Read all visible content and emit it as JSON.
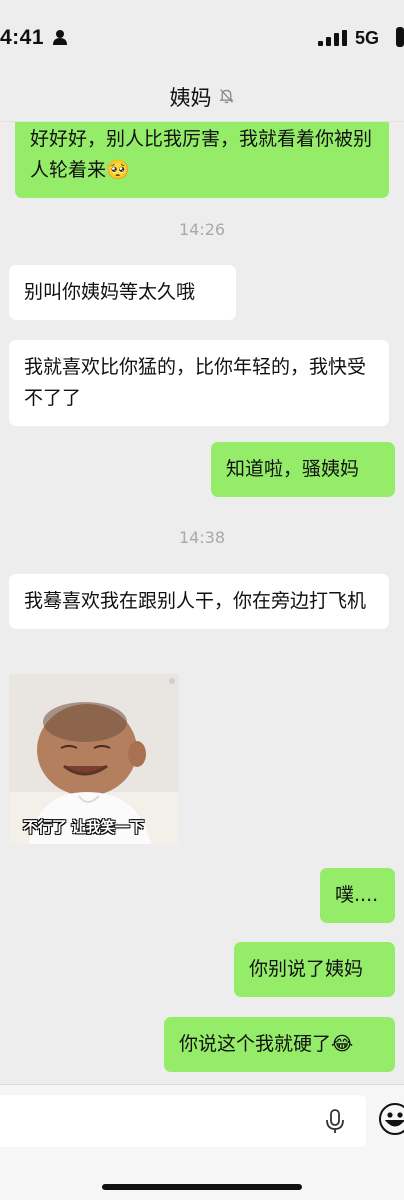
{
  "status_bar": {
    "time": "4:41",
    "network": "5G"
  },
  "header": {
    "title": "姨妈"
  },
  "messages": [
    {
      "side": "right",
      "text": "好好好，别人比我厉害，我就看着你被别人轮着来🥺"
    },
    {
      "type": "time",
      "text": "14:26"
    },
    {
      "side": "left",
      "text": "别叫你姨妈等太久哦"
    },
    {
      "side": "left",
      "text": "我就喜欢比你猛的，比你年轻的，我快受不了了"
    },
    {
      "side": "right",
      "text": "知道啦，骚姨妈"
    },
    {
      "type": "time",
      "text": "14:38"
    },
    {
      "side": "left",
      "text": "我蓦喜欢我在跟别人干，你在旁边打飞机"
    },
    {
      "side": "left",
      "type": "sticker",
      "caption": "不行了 让我笑一下"
    },
    {
      "side": "right",
      "text": "噗...."
    },
    {
      "side": "right",
      "text": "你别说了姨妈"
    },
    {
      "side": "right",
      "text": "你说这个我就硬了😂"
    }
  ],
  "input_bar": {
    "placeholder": ""
  },
  "colors": {
    "background": "#ededed",
    "own_bubble": "#95ec69",
    "other_bubble": "#ffffff",
    "timestamp": "#a9a9a9"
  },
  "icons": [
    "person-icon",
    "signal-icon",
    "battery-icon",
    "mute-bell-icon",
    "mic-icon",
    "emoji-icon"
  ]
}
